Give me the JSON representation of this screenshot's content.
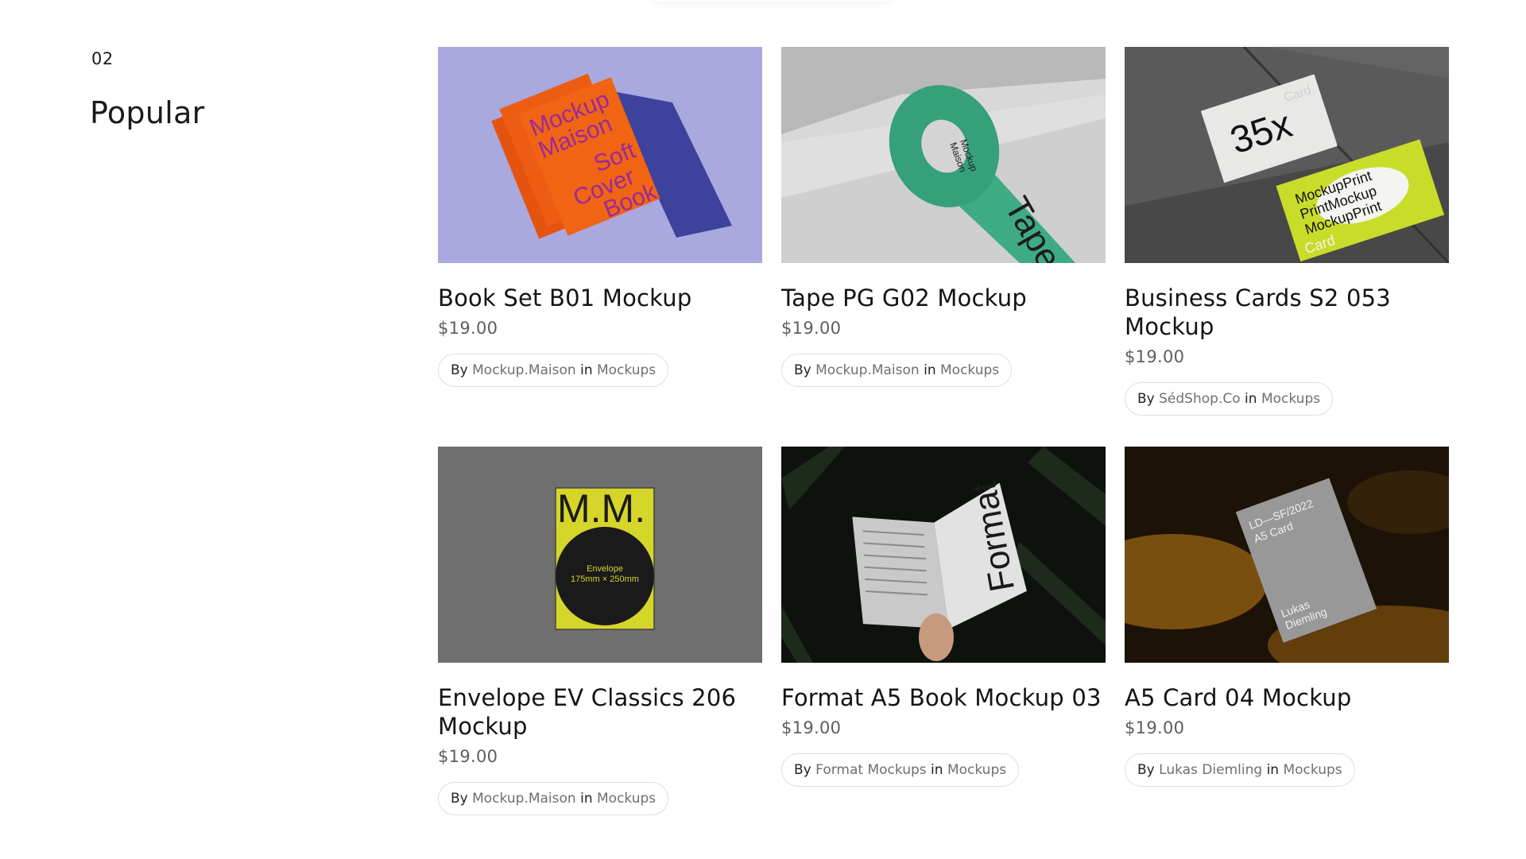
{
  "section": {
    "number": "02",
    "title": "Popular"
  },
  "products": [
    {
      "title": "Book Set B01 Mockup",
      "price": "$19.00",
      "by_label": "By",
      "author": "Mockup.Maison",
      "in_label": "in",
      "category": "Mockups",
      "image_text": {
        "line1": "Mockup",
        "line2": "Maison",
        "line3": "Soft",
        "line4": "Cover",
        "line5": "Book"
      }
    },
    {
      "title": "Tape PG G02 Mockup",
      "price": "$19.00",
      "by_label": "By",
      "author": "Mockup.Maison",
      "in_label": "in",
      "category": "Mockups",
      "image_text": {
        "tape": "Tape",
        "brand1": "Mockup",
        "brand2": "Maison"
      }
    },
    {
      "title": "Business Cards S2 053 Mockup",
      "price": "$19.00",
      "by_label": "By",
      "author": "SédShop.Co",
      "in_label": "in",
      "category": "Mockups",
      "image_text": {
        "big": "35x",
        "card": "Card",
        "print1": "MockupPrint",
        "print2": "PrintMockup",
        "print3": "MockupPrint"
      }
    },
    {
      "title": "Envelope EV Classics 206 Mockup",
      "price": "$19.00",
      "by_label": "By",
      "author": "Mockup.Maison",
      "in_label": "in",
      "category": "Mockups",
      "image_text": {
        "mm": "M.M.",
        "env1": "Envelope",
        "env2": "175mm × 250mm"
      }
    },
    {
      "title": "Format A5 Book Mockup 03",
      "price": "$19.00",
      "by_label": "By",
      "author": "Format Mockups",
      "in_label": "in",
      "category": "Mockups",
      "image_text": {
        "word": "Format"
      }
    },
    {
      "title": "A5 Card 04 Mockup",
      "price": "$19.00",
      "by_label": "By",
      "author": "Lukas Diemling",
      "in_label": "in",
      "category": "Mockups",
      "image_text": {
        "l1": "LD—SF/2022",
        "l2": "A5 Card",
        "l3": "Lukas",
        "l4": "Diemling"
      }
    }
  ]
}
